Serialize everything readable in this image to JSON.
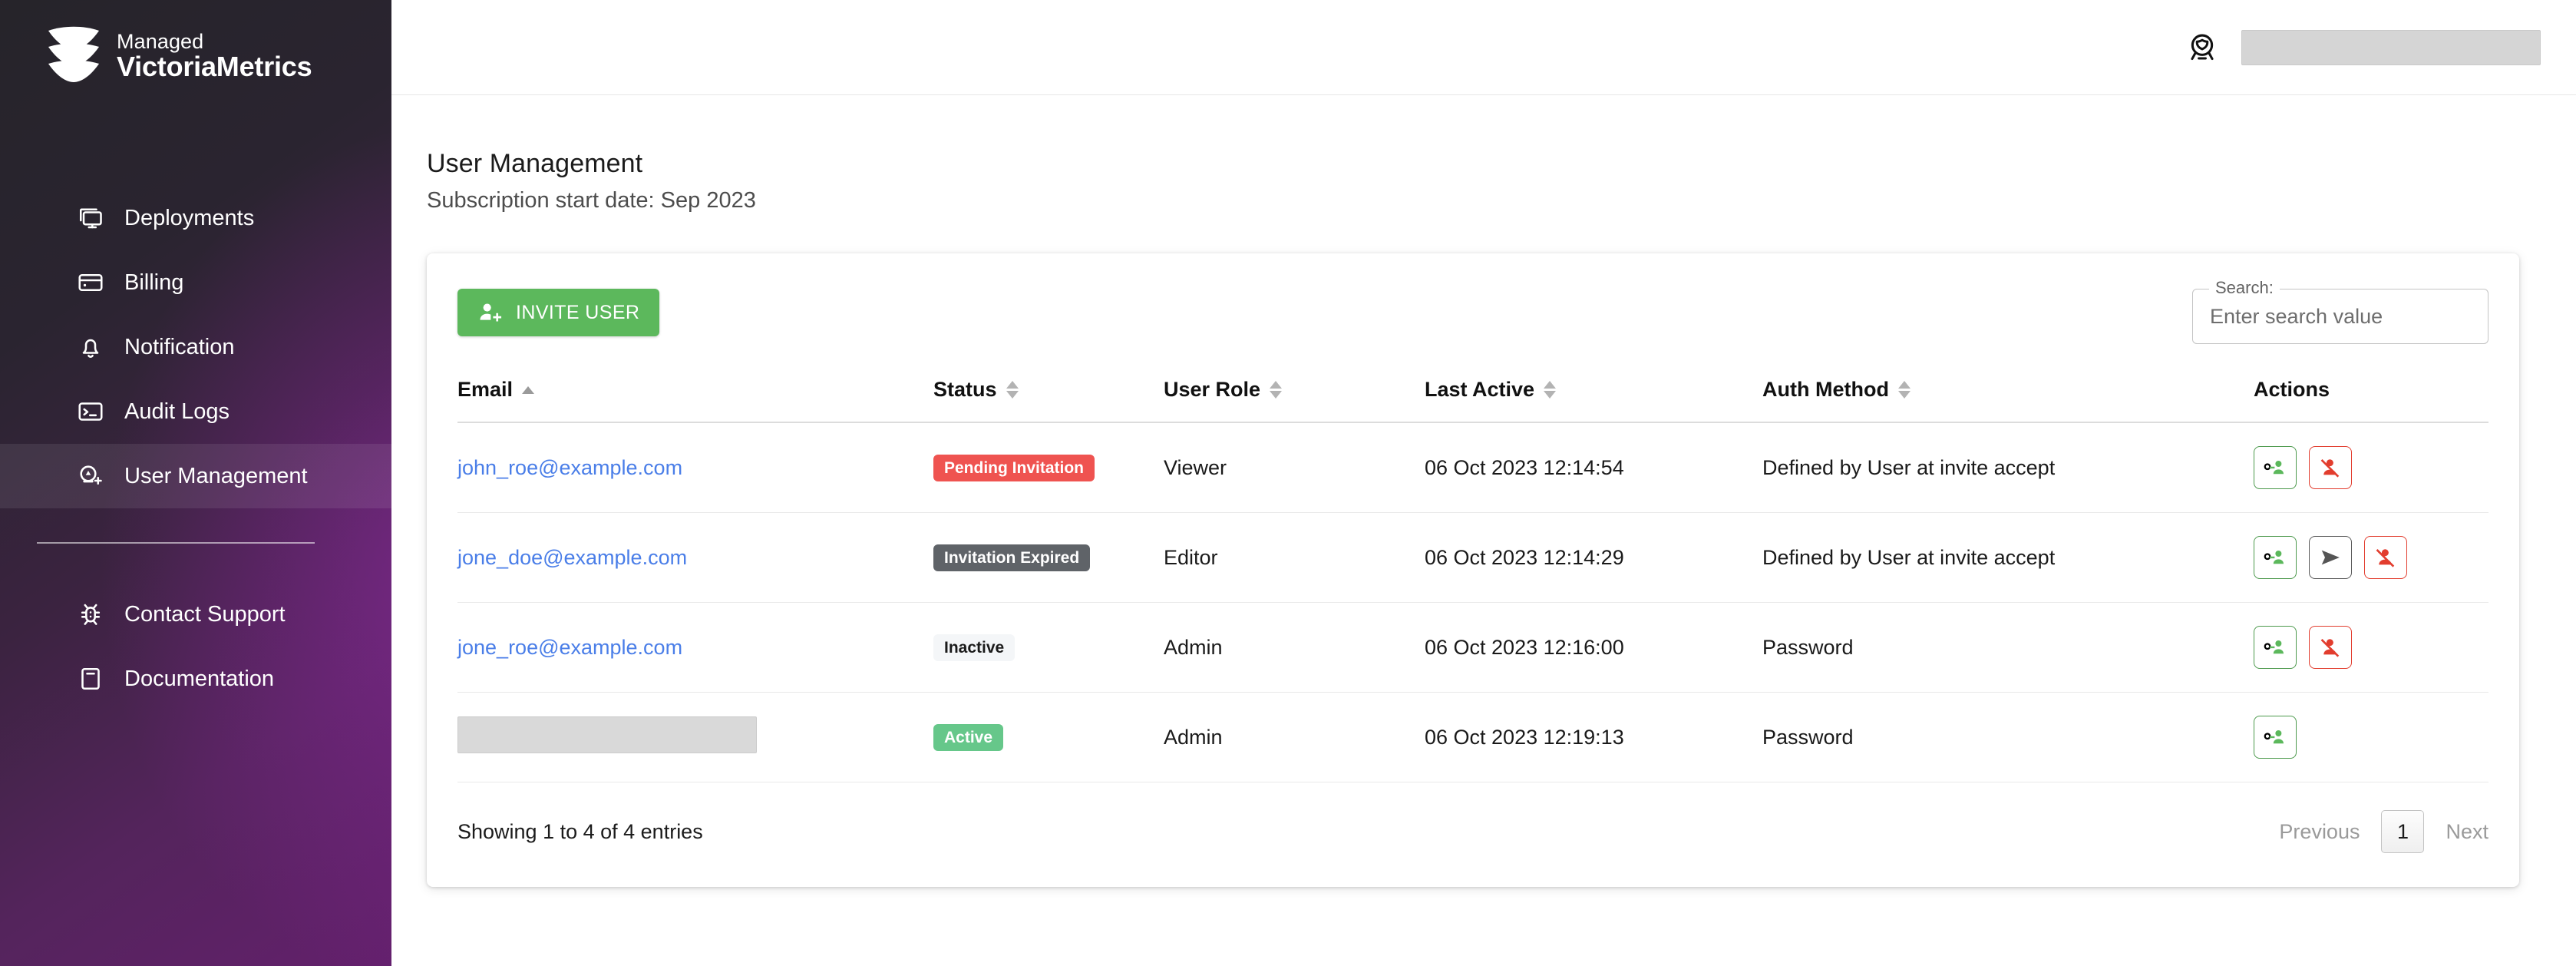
{
  "brand": {
    "top": "Managed",
    "bottom": "VictoriaMetrics",
    "logo_icon": "chevron-stack-logo"
  },
  "sidebar": {
    "items": [
      {
        "label": "Deployments",
        "icon": "monitor-icon",
        "active": false
      },
      {
        "label": "Billing",
        "icon": "credit-card-icon",
        "active": false
      },
      {
        "label": "Notification",
        "icon": "bell-icon",
        "active": false
      },
      {
        "label": "Audit Logs",
        "icon": "terminal-icon",
        "active": false
      },
      {
        "label": "User Management",
        "icon": "user-add-icon",
        "active": true
      }
    ],
    "bottom_items": [
      {
        "label": "Contact Support",
        "icon": "bug-icon"
      },
      {
        "label": "Documentation",
        "icon": "book-icon"
      }
    ]
  },
  "topbar": {
    "award_icon": "award-badge-icon",
    "account_value": ""
  },
  "page": {
    "title": "User Management",
    "subtitle": "Subscription start date: Sep 2023"
  },
  "toolbar": {
    "invite_label": "INVITE USER",
    "invite_icon": "user-plus-icon"
  },
  "search": {
    "legend": "Search:",
    "placeholder": "Enter search value",
    "value": ""
  },
  "table": {
    "columns": [
      {
        "label": "Email",
        "sortable": true,
        "sort": "asc"
      },
      {
        "label": "Status",
        "sortable": true,
        "sort": "none"
      },
      {
        "label": "User Role",
        "sortable": true,
        "sort": "none"
      },
      {
        "label": "Last Active",
        "sortable": true,
        "sort": "none"
      },
      {
        "label": "Auth Method",
        "sortable": true,
        "sort": "none"
      },
      {
        "label": "Actions",
        "sortable": false,
        "sort": "none"
      }
    ],
    "rows": [
      {
        "email": "john_roe@example.com",
        "email_redacted": false,
        "status": "Pending Invitation",
        "status_style": "danger",
        "role": "Viewer",
        "last_active": "06 Oct 2023 12:14:54",
        "auth_method": "Defined by User at invite accept",
        "actions": [
          "manage-permissions",
          "remove-user"
        ]
      },
      {
        "email": "jone_doe@example.com",
        "email_redacted": false,
        "status": "Invitation Expired",
        "status_style": "dark",
        "role": "Editor",
        "last_active": "06 Oct 2023 12:14:29",
        "auth_method": "Defined by User at invite accept",
        "actions": [
          "manage-permissions",
          "resend-invite",
          "remove-user"
        ]
      },
      {
        "email": "jone_roe@example.com",
        "email_redacted": false,
        "status": "Inactive",
        "status_style": "light",
        "role": "Admin",
        "last_active": "06 Oct 2023 12:16:00",
        "auth_method": "Password",
        "actions": [
          "manage-permissions",
          "remove-user"
        ]
      },
      {
        "email": "",
        "email_redacted": true,
        "status": "Active",
        "status_style": "success",
        "role": "Admin",
        "last_active": "06 Oct 2023 12:19:13",
        "auth_method": "Password",
        "actions": [
          "manage-permissions"
        ]
      }
    ]
  },
  "footer": {
    "entries_info": "Showing 1 to 4 of 4 entries",
    "previous": "Previous",
    "next": "Next",
    "current_page": "1"
  },
  "colors": {
    "accent_green": "#5cb85c",
    "badge_danger": "#ef5350",
    "badge_dark": "#5f6368",
    "badge_success": "#66c78a",
    "link_blue": "#4a7ee8",
    "action_red": "#e23d2e"
  }
}
